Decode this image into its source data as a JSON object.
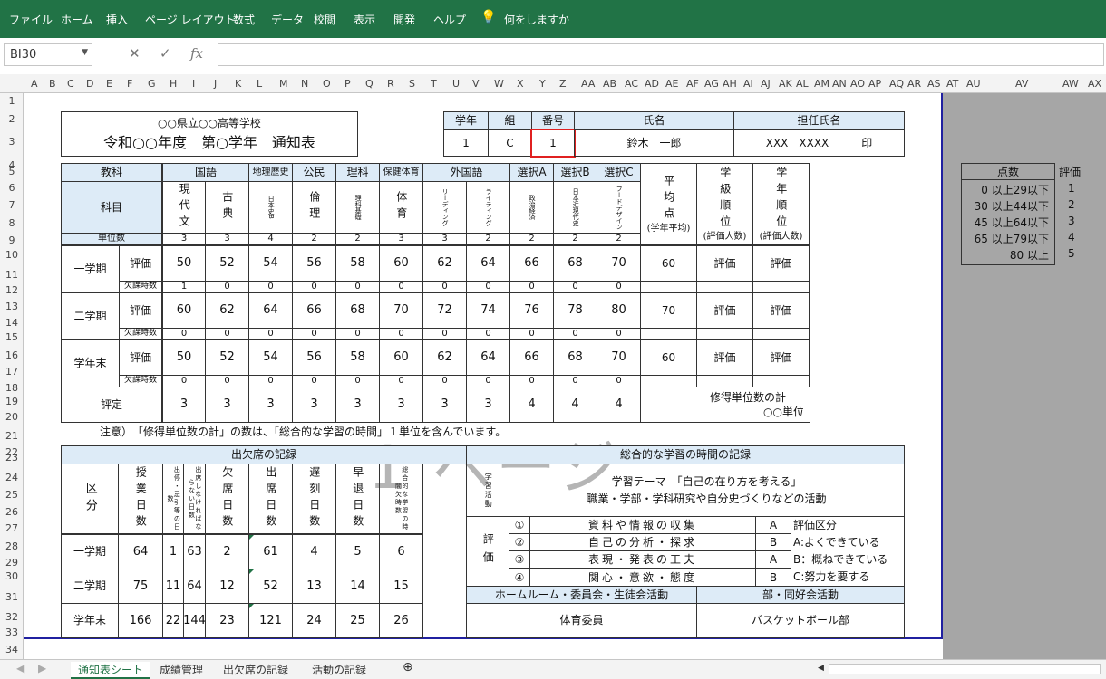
{
  "ribbon": {
    "tabs": [
      "ファイル",
      "ホーム",
      "挿入",
      "ページ レイアウト",
      "数式",
      "データ",
      "校閲",
      "表示",
      "開発",
      "ヘルプ"
    ],
    "tell_me": "何をしますか"
  },
  "formula_bar": {
    "name_box": "BI30",
    "cancel": "✕",
    "enter": "✓",
    "fx": "fx",
    "value": ""
  },
  "columns": [
    "A",
    "B",
    "C",
    "D",
    "E",
    "F",
    "G",
    "H",
    "I",
    "J",
    "K",
    "L",
    "M",
    "N",
    "O",
    "P",
    "Q",
    "R",
    "S",
    "T",
    "U",
    "V",
    "W",
    "X",
    "Y",
    "Z",
    "AA",
    "AB",
    "AC",
    "AD",
    "AE",
    "AF",
    "AG",
    "AH",
    "AI",
    "AJ",
    "AK",
    "AL",
    "AM",
    "AN",
    "AO",
    "AP",
    "AQ",
    "AR",
    "AS",
    "AT",
    "AU",
    "AV",
    "AW",
    "AX"
  ],
  "rows": [
    "1",
    "2",
    "3",
    "4",
    "5",
    "6",
    "7",
    "8",
    "9",
    "10",
    "11",
    "12",
    "13",
    "14",
    "15",
    "16",
    "17",
    "18",
    "19",
    "20",
    "21",
    "22",
    "23",
    "24",
    "25",
    "26",
    "27",
    "28",
    "29",
    "30",
    "31",
    "32",
    "33",
    "34"
  ],
  "watermark": "1 ページ",
  "header": {
    "school": "○○県立○○高等学校",
    "title": "令和○○年度　第○学年　通知表",
    "grade_label": "学年",
    "class_label": "組",
    "number_label": "番号",
    "name_label": "氏名",
    "teacher_label": "担任氏名",
    "grade": "1",
    "class": "C",
    "number": "1",
    "name": "鈴木　一郎",
    "teacher": "XXX　XXXX　　　印"
  },
  "grades": {
    "subject_label": "教科",
    "course_label": "科目",
    "units_label": "単位数",
    "subjects": [
      "国語",
      "地理歴史",
      "公民",
      "理科",
      "保健体育",
      "外国語",
      "選択A",
      "選択B",
      "選択C"
    ],
    "courses": [
      "現代文",
      "古典",
      "日本史B",
      "倫理",
      "理科基礎",
      "体育",
      "リーディング",
      "ライティング",
      "政治経済",
      "日本近現代史",
      "フードデザイン"
    ],
    "units": [
      "3",
      "3",
      "4",
      "2",
      "2",
      "3",
      "3",
      "2",
      "2",
      "2",
      "2"
    ],
    "avg_label": "平均点",
    "avg_sub": "(学年平均)",
    "class_rank_label": "学級順位",
    "class_rank_sub": "(評価人数)",
    "grade_rank_label": "学年順位",
    "grade_rank_sub": "(評価人数)",
    "eval_label": "評価",
    "absent_label": "欠課時数",
    "terms": [
      {
        "name": "一学期",
        "scores": [
          "50",
          "52",
          "54",
          "56",
          "58",
          "60",
          "62",
          "64",
          "66",
          "68",
          "70"
        ],
        "absent": [
          "1",
          "0",
          "0",
          "0",
          "0",
          "0",
          "0",
          "0",
          "0",
          "0",
          "0"
        ],
        "avg": "60",
        "class_rank": "評価",
        "grade_rank": "評価"
      },
      {
        "name": "二学期",
        "scores": [
          "60",
          "62",
          "64",
          "66",
          "68",
          "70",
          "72",
          "74",
          "76",
          "78",
          "80"
        ],
        "absent": [
          "0",
          "0",
          "0",
          "0",
          "0",
          "0",
          "0",
          "0",
          "0",
          "0",
          "0"
        ],
        "avg": "70",
        "class_rank": "評価",
        "grade_rank": "評価"
      },
      {
        "name": "学年末",
        "scores": [
          "50",
          "52",
          "54",
          "56",
          "58",
          "60",
          "62",
          "64",
          "66",
          "68",
          "70"
        ],
        "absent": [
          "0",
          "0",
          "0",
          "0",
          "0",
          "0",
          "0",
          "0",
          "0",
          "0",
          "0"
        ],
        "avg": "60",
        "class_rank": "評価",
        "grade_rank": "評価"
      }
    ],
    "final_label": "評定",
    "final": [
      "3",
      "3",
      "3",
      "3",
      "3",
      "3",
      "3",
      "3",
      "4",
      "4",
      "4"
    ],
    "credits_label": "修得単位数の計",
    "credits_value": "○○単位"
  },
  "note": "注意）　「修得単位数の計」の数は、「総合的な学習の時間」１単位を含んでいます。",
  "attendance": {
    "title": "出欠席の記録",
    "section_label": "区分",
    "headers": [
      "授業日数",
      "出停・忌引等の日数",
      "出席しなければならない日数",
      "欠席日数",
      "出席日数",
      "遅刻日数",
      "早退日数",
      "総合的な学習の時間欠時数"
    ],
    "rows": [
      {
        "name": "一学期",
        "values": [
          "64",
          "1",
          "63",
          "2",
          "61",
          "4",
          "5",
          "6"
        ]
      },
      {
        "name": "二学期",
        "values": [
          "75",
          "11",
          "64",
          "12",
          "52",
          "13",
          "14",
          "15"
        ]
      },
      {
        "name": "学年末",
        "values": [
          "166",
          "22",
          "144",
          "23",
          "121",
          "24",
          "25",
          "26"
        ]
      }
    ]
  },
  "integrated": {
    "title": "総合的な学習の時間の記録",
    "activity_label": "学習活動",
    "theme_line1": "学習テーマ　「自己の在り方を考える」",
    "theme_line2": "職業・学部・学科研究や自分史づくりなどの活動",
    "eval_label": "評価",
    "items": [
      {
        "no": "①",
        "text": "資料や情報の収集",
        "grade": "A"
      },
      {
        "no": "②",
        "text": "自己の分析・探求",
        "grade": "B"
      },
      {
        "no": "③",
        "text": "表現・発表の工夫",
        "grade": "A"
      },
      {
        "no": "④",
        "text": "関心・意欲・態度",
        "grade": "B"
      }
    ],
    "scale": [
      "評価区分",
      "A:よくできている",
      "B：概ねできている",
      "C:努力を要する"
    ]
  },
  "activities": {
    "hr_label": "ホームルーム・委員会・生徒会活動",
    "club_label": "部・同好会活動",
    "hr_value": "体育委員",
    "club_value": "バスケットボール部"
  },
  "scores_table": {
    "header": "点数",
    "eval_header": "評価",
    "rows": [
      {
        "range": "0 以上29以下",
        "eval": "1"
      },
      {
        "range": "30 以上44以下",
        "eval": "2"
      },
      {
        "range": "45 以上64以下",
        "eval": "3"
      },
      {
        "range": "65 以上79以下",
        "eval": "4"
      },
      {
        "range": "80 以上",
        "eval": "5"
      }
    ]
  },
  "sheet_tabs": [
    "通知表シート",
    "成績管理",
    "出欠席の記録",
    "活動の記録"
  ]
}
